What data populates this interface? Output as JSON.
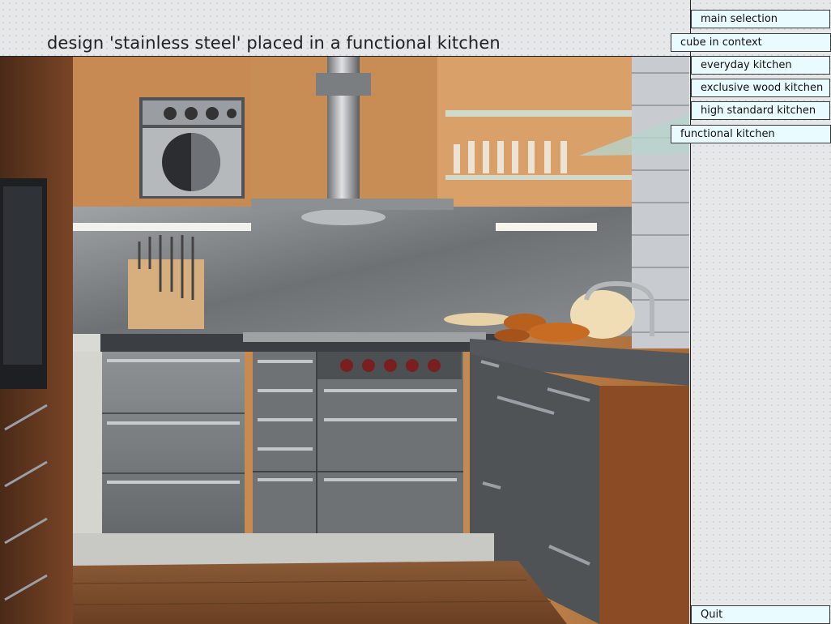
{
  "page": {
    "title": "design 'stainless steel' placed in a functional kitchen"
  },
  "nav": {
    "main_selection": "main selection",
    "cube_in_context": "cube in context",
    "everyday_kitchen": "everyday kitchen",
    "exclusive_wood_kitchen": "exclusive wood kitchen",
    "high_standard_kitchen": "high standard kitchen",
    "functional_kitchen": "functional kitchen",
    "quit": "Quit"
  },
  "colors": {
    "nav_button_bg": "#e9fbff",
    "panel_bg": "#e6e7e9"
  },
  "photo": {
    "icon": "kitchen-photo"
  }
}
